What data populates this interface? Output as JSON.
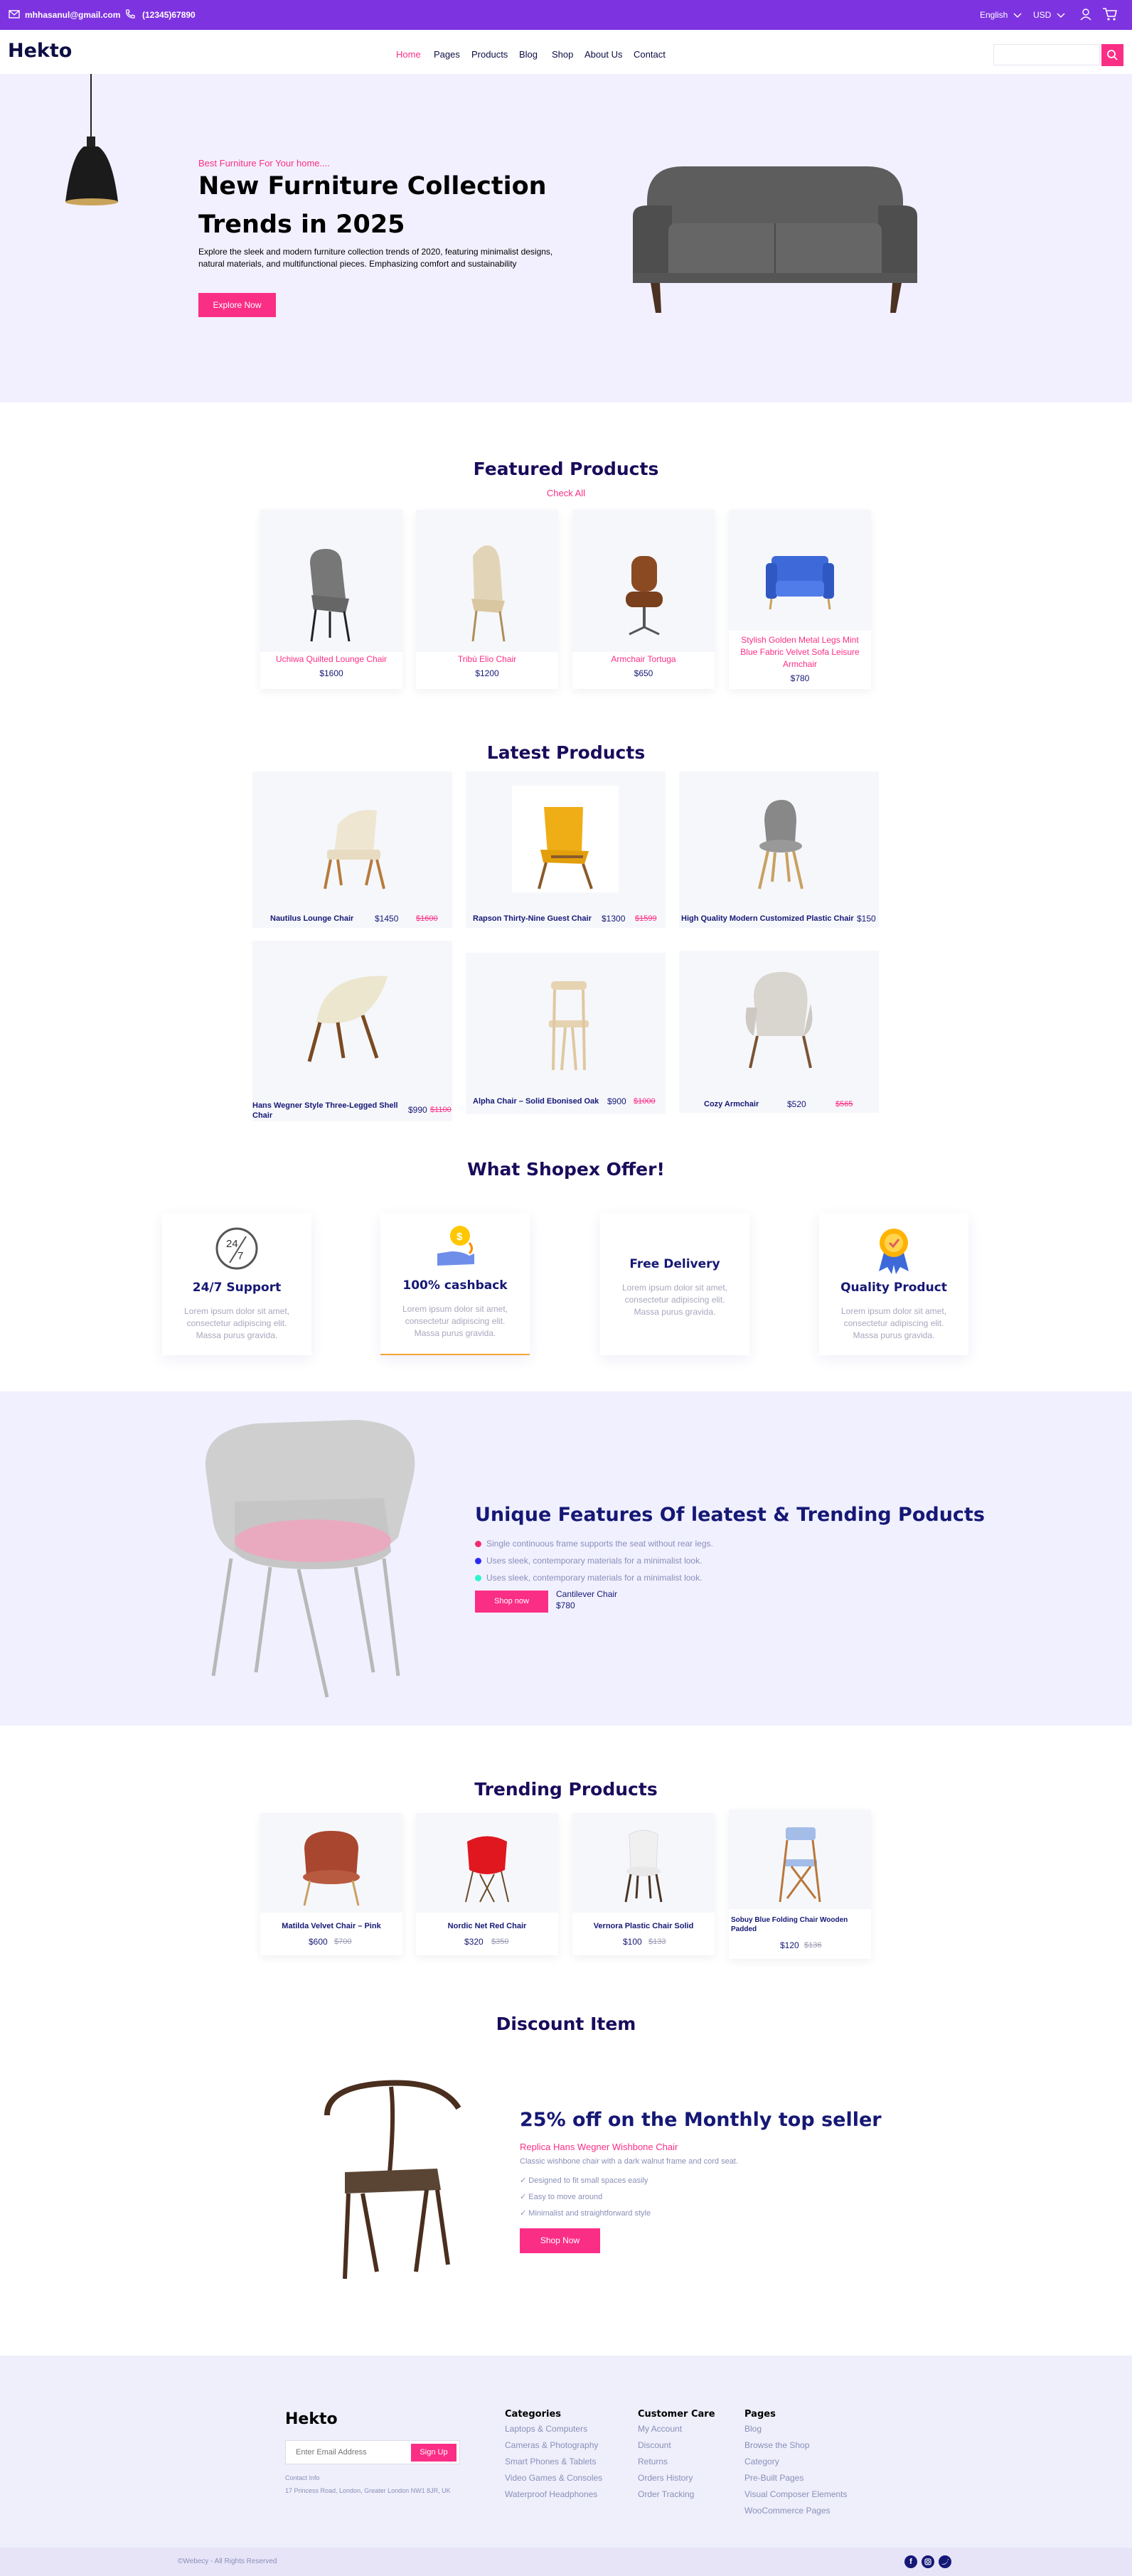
{
  "topbar": {
    "email": "mhhasanul@gmail.com",
    "phone": "(12345)67890",
    "language": "English",
    "currency": "USD"
  },
  "nav": {
    "logo": "Hekto",
    "links": [
      "Home",
      "Pages",
      "Products",
      "Blog",
      "Shop",
      "About Us",
      "Contact"
    ],
    "search_placeholder": ""
  },
  "hero": {
    "tagline": "Best Furniture For Your home....",
    "title_line1": "New Furniture Collection",
    "title_line2": "Trends in 2025",
    "description_line1": "Explore the sleek and modern furniture collection trends of 2020, featuring minimalist designs,",
    "description_line2": "natural materials, and multifunctional pieces. Emphasizing comfort and sustainability",
    "button": "Explore Now"
  },
  "featured": {
    "title": "Featured Products",
    "link": "Check All",
    "items": [
      {
        "name": "Uchiwa Quilted Lounge Chair",
        "price": "$1600"
      },
      {
        "name": "Tribù Elio Chair",
        "price": "$1200"
      },
      {
        "name": "Armchair Tortuga",
        "price": "$650"
      },
      {
        "name_lines": [
          "Stylish Golden Metal Legs Mint",
          "Blue Fabric Velvet Sofa Leisure",
          "Armchair"
        ],
        "price": "$780"
      }
    ]
  },
  "latest": {
    "title": "Latest Products",
    "items": [
      {
        "name": "Nautilus Lounge Chair",
        "price": "$1450",
        "old": "$1600"
      },
      {
        "name": "Rapson Thirty-Nine Guest Chair",
        "price": "$1300",
        "old": "$1599"
      },
      {
        "name": "High Quality Modern Customized Plastic Chair",
        "price": "$150",
        "old": ""
      },
      {
        "name_lines": [
          "Hans Wegner Style Three-Legged Shell",
          "Chair"
        ],
        "price": "$990",
        "old": "$1100"
      },
      {
        "name": "Alpha Chair – Solid Ebonised Oak",
        "price": "$900",
        "old": "$1000"
      },
      {
        "name": "Cozy Armchair",
        "price": "$520",
        "old": "$565"
      }
    ]
  },
  "offer": {
    "title": "What Shopex Offer!",
    "lorem_lines": [
      "Lorem ipsum dolor sit amet,",
      "consectetur adipiscing elit.",
      "Massa purus gravida."
    ],
    "items": [
      {
        "title": "24/7 Support",
        "icon": "support-24-7-icon"
      },
      {
        "title": "100% cashback",
        "icon": "cashback-icon"
      },
      {
        "title": "Free Delivery",
        "icon": "delivery-icon"
      },
      {
        "title": "Quality Product",
        "icon": "quality-badge-icon"
      }
    ]
  },
  "unique": {
    "title": "Unique Features Of leatest & Trending Poducts",
    "bullets": [
      {
        "text": "Single continuous frame supports the seat without rear legs.",
        "color": "#f52b70"
      },
      {
        "text": "Uses sleek, contemporary materials for a minimalist look.",
        "color": "#2b2bf5"
      },
      {
        "text": "Uses sleek, contemporary materials for a minimalist look.",
        "color": "#2bf5cc"
      }
    ],
    "button": "Shop now",
    "product_name": "Cantilever Chair",
    "product_price": "$780"
  },
  "trending": {
    "title": "Trending Products",
    "items": [
      {
        "name": "Matilda Velvet Chair – Pink",
        "price": "$600",
        "old": "$700"
      },
      {
        "name": "Nordic Net Red Chair",
        "price": "$320",
        "old": "$350"
      },
      {
        "name": "Vernora Plastic Chair Solid",
        "price": "$100",
        "old": "$133"
      },
      {
        "name_lines": [
          "Sobuy Blue Folding Chair Wooden",
          "Padded"
        ],
        "price": "$120",
        "old": "$136"
      }
    ]
  },
  "discount": {
    "title": "Discount Item",
    "headline": "25% off on the Monthly top seller",
    "product": "Replica Hans Wegner Wishbone Chair",
    "desc": "Classic wishbone chair with a dark walnut frame and cord seat.",
    "checks": [
      "Designed to fit small spaces easily",
      "Easy to move around",
      "Minimalist and straightforward style"
    ],
    "button": "Shop Now"
  },
  "footer": {
    "logo": "Hekto",
    "email_placeholder": "Enter Email Address",
    "signup": "Sign Up",
    "contact_label": "Contact Info",
    "address": "17 Princess Road, London, Greater London NW1 8JR, UK",
    "columns": [
      {
        "title": "Categories",
        "links": [
          "Laptops & Computers",
          "Cameras & Photography",
          "Smart Phones & Tablets",
          "Video Games & Consoles",
          "Waterproof Headphones"
        ]
      },
      {
        "title": "Customer Care",
        "links": [
          "My Account",
          "Discount",
          "Returns",
          "Orders History",
          "Order Tracking"
        ]
      },
      {
        "title": "Pages",
        "links": [
          "Blog",
          "Browse the Shop",
          "Category",
          "Pre-Built Pages",
          "Visual Composer Elements",
          "WooCommerce Pages"
        ]
      }
    ],
    "copyright": "©Webecy - All Rights Reserved",
    "social": [
      "facebook-icon",
      "instagram-icon",
      "twitter-icon"
    ]
  },
  "colors": {
    "accent": "#fb2e86",
    "purple": "#7e33e0",
    "navy": "#151875",
    "hero_bg": "#f2f0ff"
  }
}
